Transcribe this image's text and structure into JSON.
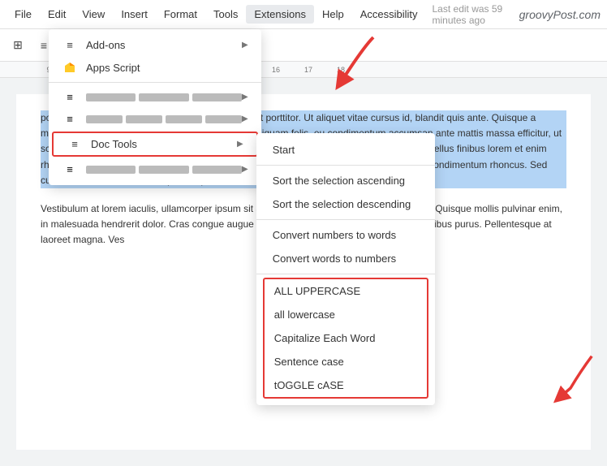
{
  "menuBar": {
    "items": [
      "File",
      "Edit",
      "View",
      "Insert",
      "Format",
      "Tools",
      "Extensions",
      "Help",
      "Accessibility"
    ],
    "activeItem": "Extensions",
    "lastEdit": "Last edit was 59 minutes ago",
    "brand": "groovyPost.com"
  },
  "extensionsMenu": {
    "items": [
      {
        "id": "addons",
        "icon": "≡",
        "label": "Add-ons",
        "hasArrow": true,
        "blurred": false
      },
      {
        "id": "appsscript",
        "icon": "🔺",
        "label": "Apps Script",
        "hasArrow": false,
        "blurred": false
      },
      {
        "id": "blurred1",
        "icon": "≡",
        "label": "",
        "hasArrow": true,
        "blurred": true
      },
      {
        "id": "blurred2",
        "icon": "≡",
        "label": "",
        "hasArrow": true,
        "blurred": true
      },
      {
        "id": "doctools",
        "icon": "≡",
        "label": "Doc Tools",
        "hasArrow": true,
        "blurred": false,
        "highlighted": true
      },
      {
        "id": "blurred3",
        "icon": "≡",
        "label": "",
        "hasArrow": true,
        "blurred": true
      }
    ]
  },
  "docToolsSubmenu": {
    "items": [
      {
        "id": "start",
        "label": "Start",
        "group": "normal"
      },
      {
        "id": "sort-asc",
        "label": "Sort the selection ascending",
        "group": "normal"
      },
      {
        "id": "sort-desc",
        "label": "Sort the selection descending",
        "group": "normal"
      },
      {
        "id": "sep1",
        "type": "separator"
      },
      {
        "id": "num-to-words",
        "label": "Convert numbers to words",
        "group": "normal"
      },
      {
        "id": "words-to-num",
        "label": "Convert words to numbers",
        "group": "normal"
      },
      {
        "id": "sep2",
        "type": "separator"
      },
      {
        "id": "uppercase",
        "label": "ALL UPPERCASE",
        "group": "outlined"
      },
      {
        "id": "lowercase",
        "label": "all lowercase",
        "group": "outlined"
      },
      {
        "id": "capitalize",
        "label": "Capitalize Each Word",
        "group": "outlined"
      },
      {
        "id": "sentence",
        "label": "Sentence case",
        "group": "outlined"
      },
      {
        "id": "toggle",
        "label": "tOGGLE cASE",
        "group": "outlined"
      }
    ]
  },
  "document": {
    "paragraph1": "porta non lectus. Maecenas a enim nec odio aliquet porttitor. Ut aliquet vitae cursus id, blandit quis ante. Quisque a molestie sem, vel venenatis. Pellentesque iaculis aliquam felis, eu condimentum accumsan ante mattis massa efficitur, ut scelerisque sem int tellus a ullamcorper. Etiam vel consequat elit, id porttitor dictumst. Phasellus finibus lorem et enim rhoncus, at viverra urna vitae dignissim ornare, est nibh fringilla felis, ut viverra tortor eget condimentum rhoncus. Sed cursus, dui eu ultrices enim, quis tempor ante risus pretium ex.",
    "paragraph2": "Vestibulum at lorem iaculis, ullamcorper ipsum sit amet, aliquet vitae ultrices leo semper in. Quisque mollis pulvinar enim, in malesuada hendrerit dolor. Cras congue augue on neque viverra vulputate id, ornare dapibus purus. Pellentesque at laoreet magna. Ves"
  }
}
